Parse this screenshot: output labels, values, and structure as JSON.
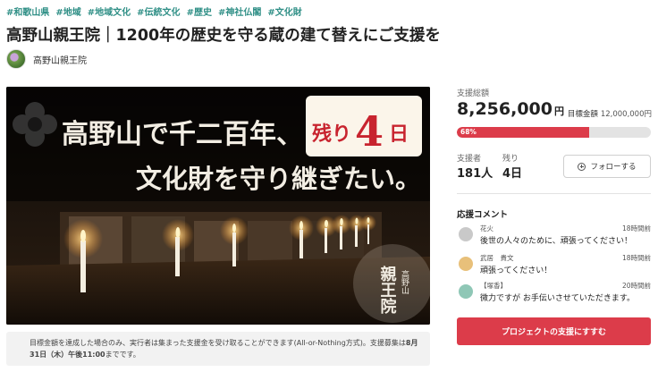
{
  "tags": [
    "#和歌山県",
    "#地域",
    "#地域文化",
    "#伝統文化",
    "#歴史",
    "#神社仏閣",
    "#文化財"
  ],
  "title": "高野山親王院｜1200年の歴史を守る蔵の建て替えにご支援を",
  "owner": {
    "name": "高野山親王院"
  },
  "hero": {
    "line1": "高野山で千二百年、",
    "line2": "文化財を守り継ぎたい。",
    "days_badge_prefix": "残り",
    "days_badge_number": "4",
    "days_badge_suffix": "日",
    "seal_small": "高野山",
    "seal_big": "親王院"
  },
  "notice": {
    "text_pre": "目標金額を達成した場合のみ、実行者は集まった支援金を受け取ることができます(All-or-Nothing方式)。支援募集は",
    "deadline": "8月31日（木）午後11:00",
    "text_post": "までです。"
  },
  "funding": {
    "total_label": "支援総額",
    "total_amount": "8,256,000",
    "total_unit": "円",
    "goal_label": "目標金額",
    "goal_amount": "12,000,000円",
    "progress_percent": 68,
    "progress_label": "68%",
    "supporters_label": "支援者",
    "supporters_value": "181人",
    "days_left_label": "残り",
    "days_left_value": "4日",
    "follow_label": "フォローする"
  },
  "comments": {
    "heading": "応援コメント",
    "items": [
      {
        "name": "花火",
        "time": "18時間前",
        "text": "後世の人々のために、頑張ってください！",
        "avatar_color": "#c9c9c9"
      },
      {
        "name": "武居　貴文",
        "time": "18時間前",
        "text": "頑張ってください！",
        "avatar_color": "#e8c07a"
      },
      {
        "name": "【塚香】",
        "time": "20時間前",
        "text": "微力ですが お手伝いさせていただきます。",
        "avatar_color": "#8fc7b6"
      }
    ]
  },
  "support_button_label": "プロジェクトの支援にすすむ",
  "colors": {
    "accent": "#dc3c4a",
    "tag": "#2f8f86"
  }
}
